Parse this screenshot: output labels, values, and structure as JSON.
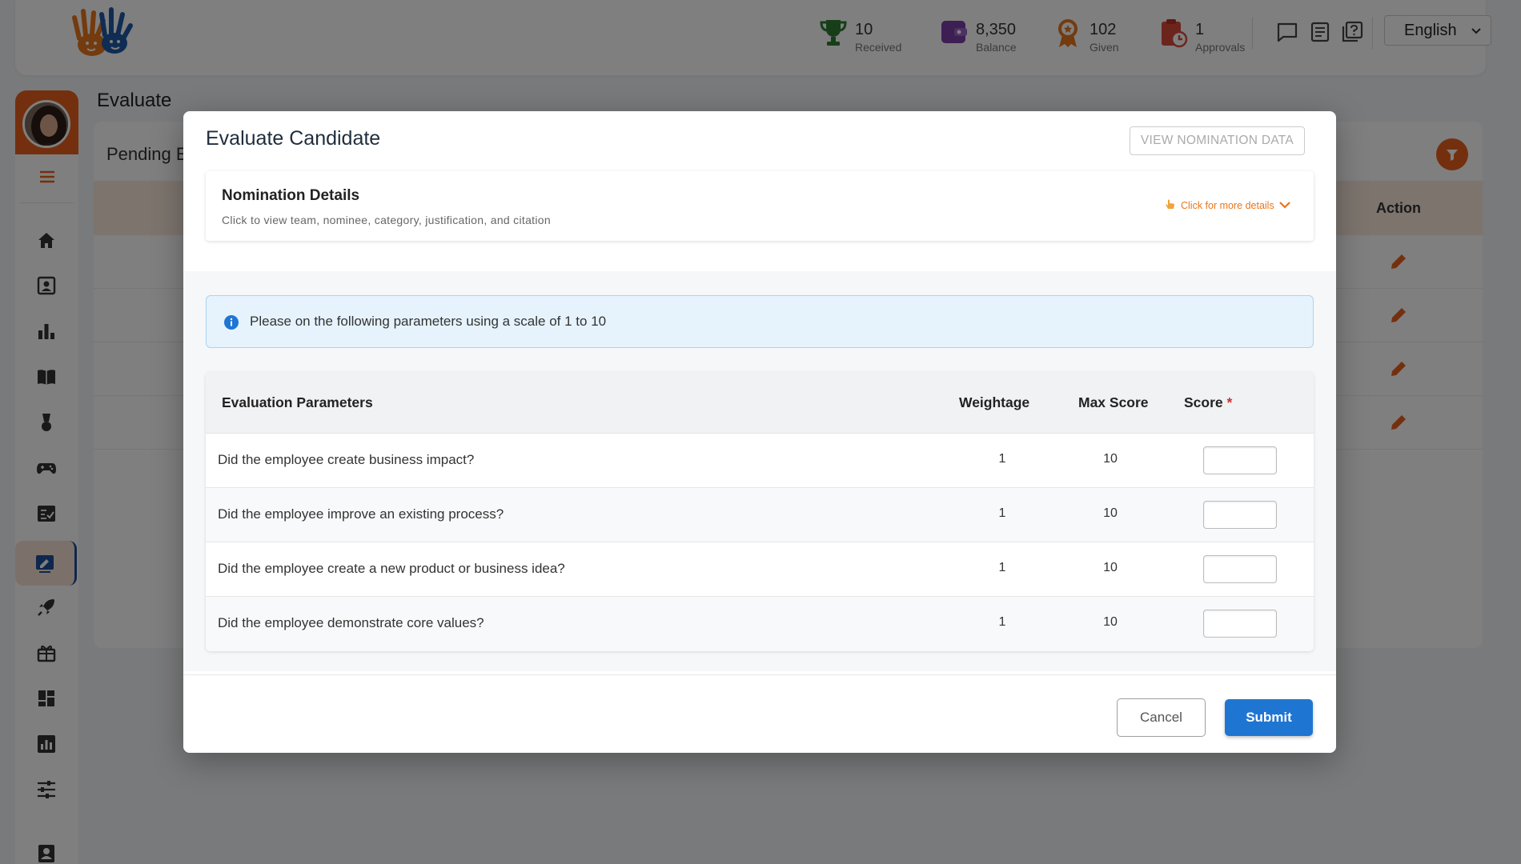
{
  "header": {
    "stats": [
      {
        "value": "10",
        "label": "Received",
        "icon": "trophy-icon"
      },
      {
        "value": "8,350",
        "label": "Balance",
        "icon": "wallet-icon"
      },
      {
        "value": "102",
        "label": "Given",
        "icon": "award-icon"
      },
      {
        "value": "1",
        "label": "Approvals",
        "icon": "clipboard-clock-icon"
      }
    ],
    "language": "English"
  },
  "page": {
    "title": "Evaluate",
    "card_title": "Pending E",
    "action_header": "Action"
  },
  "modal": {
    "title": "Evaluate Candidate",
    "view_nomination_label": "VIEW NOMINATION DATA",
    "nomination": {
      "title": "Nomination Details",
      "subtitle": "Click to view team, nominee, category, justification, and citation",
      "more_label": "Click for more details"
    },
    "info_text": "Please on the following parameters using a scale of 1 to 10",
    "table": {
      "headers": {
        "parameter": "Evaluation Parameters",
        "weightage": "Weightage",
        "max_score": "Max Score",
        "score": "Score",
        "required_mark": "*"
      },
      "rows": [
        {
          "question": "Did the employee create business impact?",
          "weightage": "1",
          "max_score": "10",
          "score": ""
        },
        {
          "question": "Did the employee improve an existing process?",
          "weightage": "1",
          "max_score": "10",
          "score": ""
        },
        {
          "question": "Did the employee create a new product or business idea?",
          "weightage": "1",
          "max_score": "10",
          "score": ""
        },
        {
          "question": "Did the employee demonstrate core values?",
          "weightage": "1",
          "max_score": "10",
          "score": ""
        }
      ]
    },
    "cancel_label": "Cancel",
    "submit_label": "Submit"
  },
  "colors": {
    "accent_orange": "#e8601c",
    "primary_blue": "#1f76d2",
    "info_bg": "#e6f3fd"
  }
}
